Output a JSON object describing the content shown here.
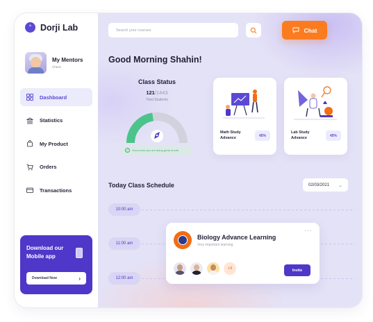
{
  "app": {
    "logo_letter": "°",
    "name": "Dorji Lab"
  },
  "mentor": {
    "title": "My Mentors",
    "subtitle": "Check"
  },
  "nav": [
    {
      "label": "Dashboard",
      "icon": "grid-icon",
      "active": true
    },
    {
      "label": "Statistics",
      "icon": "bank-icon",
      "active": false
    },
    {
      "label": "My Product",
      "icon": "shopping-bag-icon",
      "active": false
    },
    {
      "label": "Orders",
      "icon": "cart-icon",
      "active": false
    },
    {
      "label": "Transactions",
      "icon": "card-icon",
      "active": false
    }
  ],
  "promo": {
    "text": "Download our Mobile app",
    "button": "Download Now"
  },
  "search": {
    "placeholder": "Search your courses"
  },
  "chat": {
    "label": "Chat"
  },
  "greeting": "Good Morning Shahin!",
  "class_status": {
    "title": "Class Status",
    "count": "121",
    "total": "1443",
    "label": "Total Students",
    "note": "Good work you are doing great month",
    "gauge_fraction": 0.45
  },
  "cards": [
    {
      "title": "Math Study Advance",
      "percent": "45%"
    },
    {
      "title": "Lab Study Advance",
      "percent": "45%"
    }
  ],
  "schedule": {
    "title": "Today Class Schedule",
    "date": "02/03/2021",
    "times": [
      "10:00 am",
      "11:00 am",
      "12:00 am"
    ]
  },
  "event": {
    "title": "Biology Advance Learning",
    "subtitle": "Very important learning",
    "more_count": "+3",
    "invite": "Invite"
  },
  "colors": {
    "accent": "#5b49d6",
    "orange": "#fb7c1f",
    "green": "#4cc38a"
  }
}
